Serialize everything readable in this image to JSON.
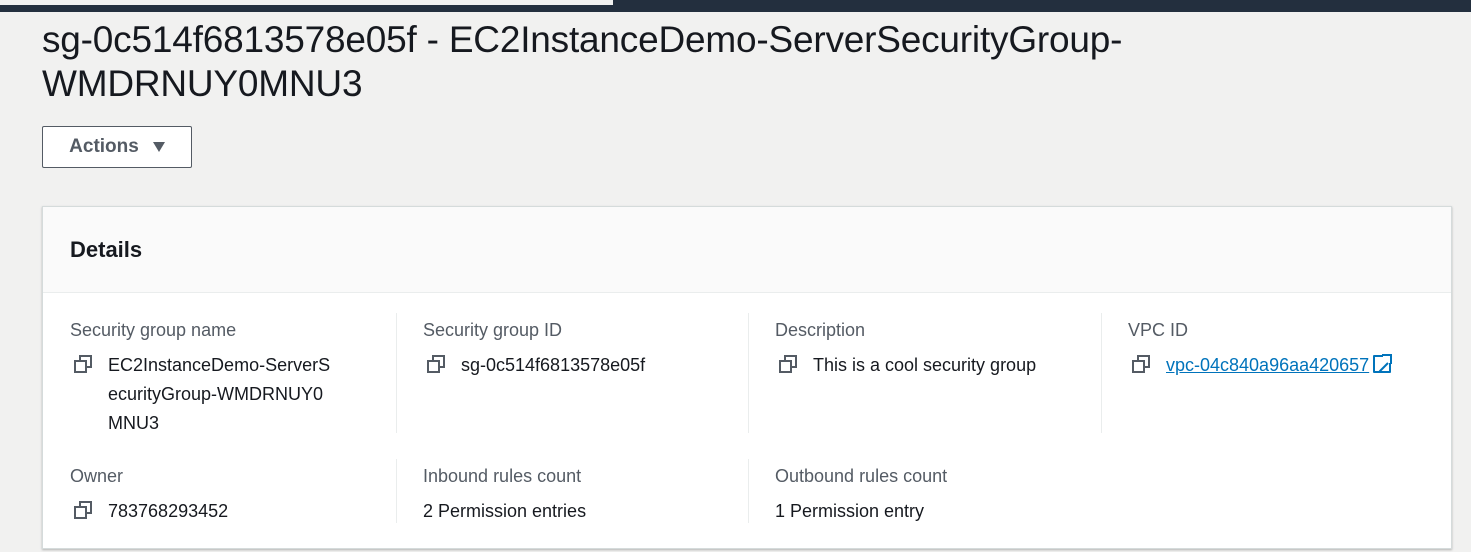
{
  "page": {
    "title": "sg-0c514f6813578e05f - EC2InstanceDemo-ServerSecurityGroup-WMDRNUY0MNU3",
    "actions_label": "Actions"
  },
  "details": {
    "header": "Details",
    "security_group_name": {
      "label": "Security group name",
      "value": "EC2InstanceDemo-ServerSecurityGroup-WMDRNUY0MNU3"
    },
    "security_group_id": {
      "label": "Security group ID",
      "value": "sg-0c514f6813578e05f"
    },
    "description": {
      "label": "Description",
      "value": "This is a cool security group"
    },
    "vpc_id": {
      "label": "VPC ID",
      "value": "vpc-04c840a96aa420657"
    },
    "owner": {
      "label": "Owner",
      "value": "783768293452"
    },
    "inbound_rules_count": {
      "label": "Inbound rules count",
      "value": "2 Permission entries"
    },
    "outbound_rules_count": {
      "label": "Outbound rules count",
      "value": "1 Permission entry"
    }
  },
  "icons": {
    "copy": "copy-icon",
    "external_link": "external-link-icon",
    "dropdown": "caret-down-icon"
  },
  "colors": {
    "link": "#0073bb",
    "text": "#16191f",
    "label": "#545b64",
    "background": "#f1f1f0"
  }
}
